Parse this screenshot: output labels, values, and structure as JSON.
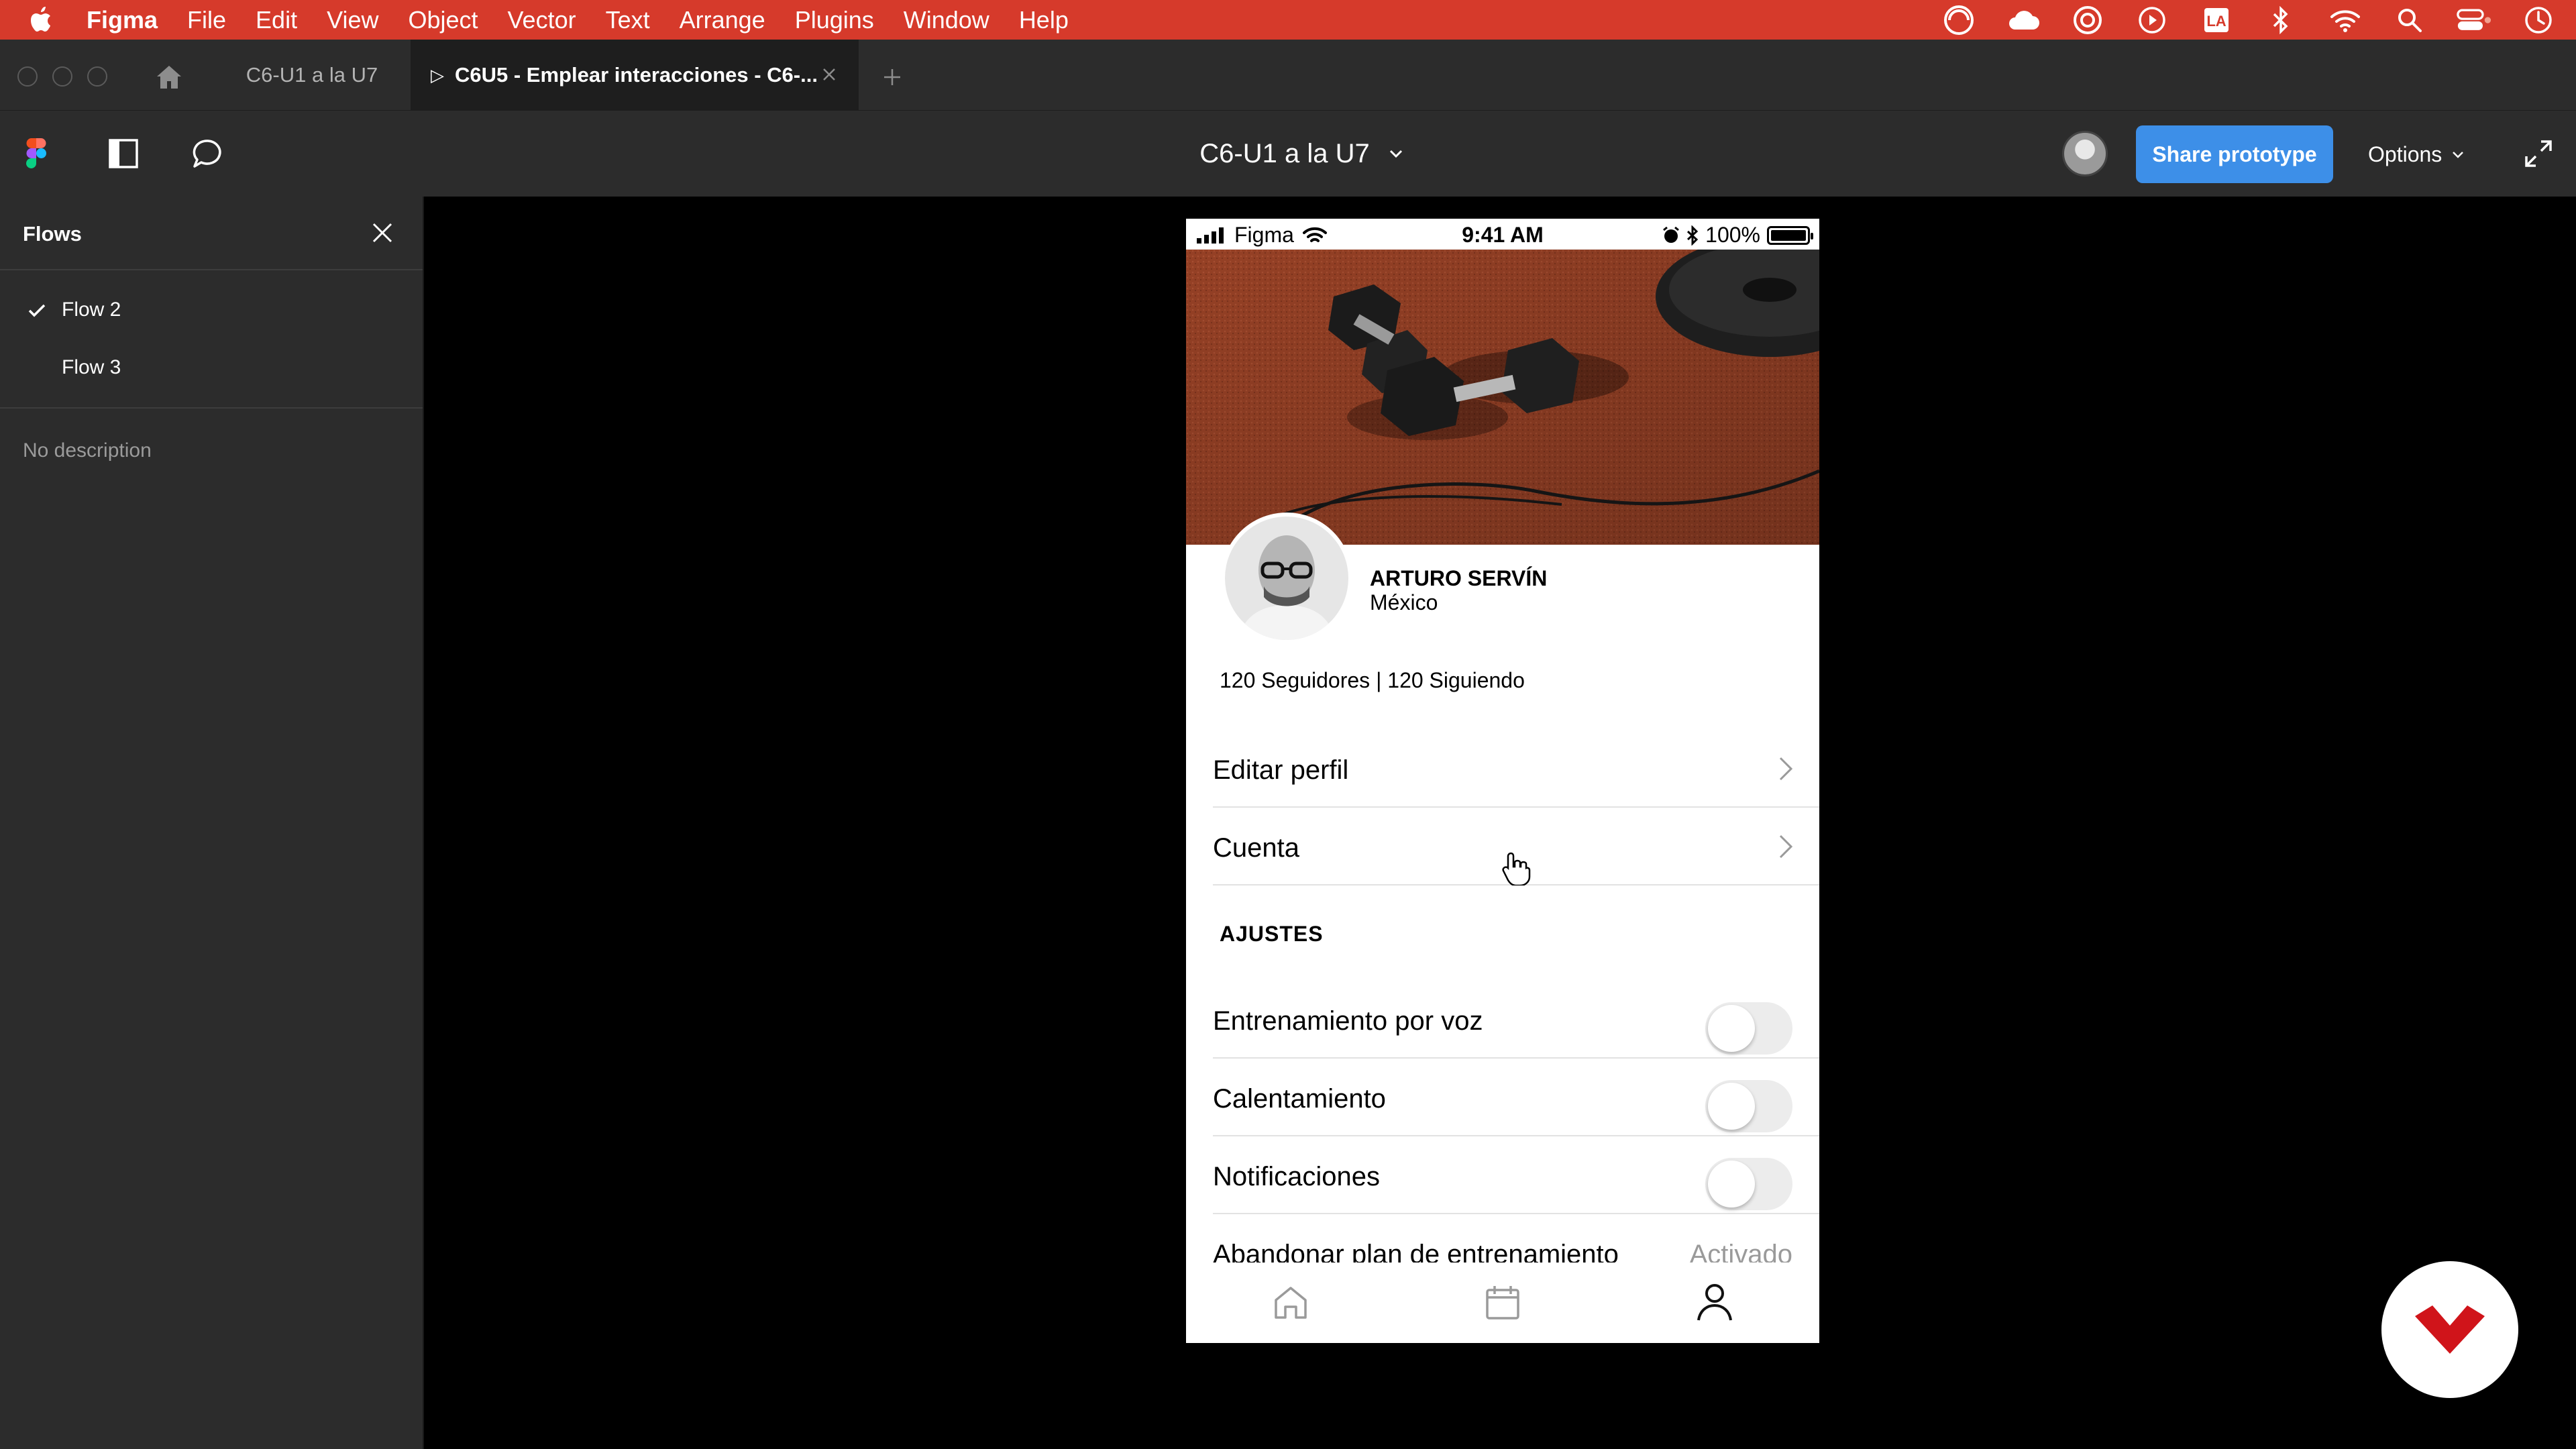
{
  "menubar": {
    "app": "Figma",
    "items": [
      "File",
      "Edit",
      "View",
      "Object",
      "Vector",
      "Text",
      "Arrange",
      "Plugins",
      "Window",
      "Help"
    ],
    "accent": "#d63a2b"
  },
  "tabs": [
    {
      "label": "C6-U1 a la U7"
    },
    {
      "label": "C6U5 - Emplear interacciones - C6-..."
    }
  ],
  "toolbar": {
    "doc_title": "C6-U1 a la U7",
    "share_label": "Share prototype",
    "options_label": "Options",
    "share_color": "#3d8fe8"
  },
  "sidebar": {
    "title": "Flows",
    "flows": [
      {
        "label": "Flow 2",
        "selected": true
      },
      {
        "label": "Flow 3",
        "selected": false
      }
    ],
    "description": "No description"
  },
  "phone": {
    "status": {
      "carrier": "Figma",
      "time": "9:41 AM",
      "battery": "100%"
    },
    "profile": {
      "name": "ARTURO SERVÍN",
      "country": "México",
      "stats": "120 Seguidores | 120 Siguiendo"
    },
    "menu": [
      {
        "label": "Editar perfil"
      },
      {
        "label": "Cuenta"
      }
    ],
    "section_title": "AJUSTES",
    "settings": [
      {
        "label": "Entrenamiento por voz",
        "enabled": false
      },
      {
        "label": "Calentamiento",
        "enabled": false
      },
      {
        "label": "Notificaciones",
        "enabled": false
      }
    ],
    "partial_row": {
      "label": "Abandonar plan de entrenamiento",
      "value": "Activado"
    },
    "nav": [
      "home-icon",
      "calendar-icon",
      "profile-icon"
    ]
  }
}
